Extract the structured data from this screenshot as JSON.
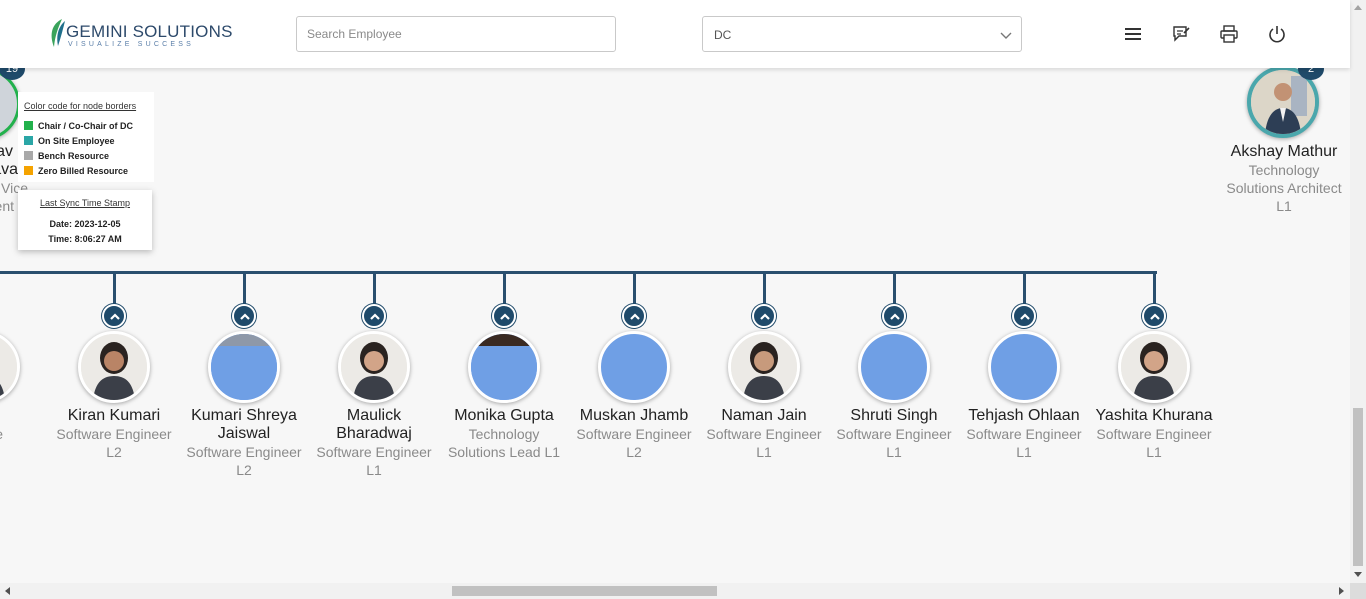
{
  "header": {
    "logo_title": "GEMINI SOLUTIONS",
    "logo_tagline": "VISUALIZE SUCCESS",
    "search_placeholder": "Search Employee",
    "dc_select_value": "DC",
    "icons": [
      "menu-icon",
      "feedback-icon",
      "print-icon",
      "power-icon"
    ]
  },
  "legend": {
    "title": "Color code for node borders",
    "items": [
      {
        "label": "Chair / Co-Chair of DC",
        "color": "#22b14c"
      },
      {
        "label": "On Site Employee",
        "color": "#2aa6a6"
      },
      {
        "label": "Bench Resource",
        "color": "#a9a9a9"
      },
      {
        "label": "Zero Billed Resource",
        "color": "#f5a300"
      }
    ]
  },
  "sync": {
    "title": "Last Sync Time Stamp",
    "date": "Date: 2023-12-05",
    "time": "Time: 8:06:27 AM"
  },
  "partial_left_node": {
    "count": "19",
    "name_line1": "av",
    "name_line2": "ava",
    "role_line1": "Vice",
    "role_line2": "ent"
  },
  "right_node": {
    "count": "2",
    "name": "Akshay Mathur",
    "role_line1": "Technology",
    "role_line2": "Solutions Architect",
    "role_line3": "L1"
  },
  "children": [
    {
      "name_line1": "huja",
      "name_line2": "",
      "role_line1": "ftware",
      "role_line2": "r L1",
      "role_line3": "",
      "photo": true
    },
    {
      "name_line1": "Kiran Kumari",
      "name_line2": "",
      "role_line1": "Software Engineer",
      "role_line2": "L2",
      "role_line3": "",
      "photo": true
    },
    {
      "name_line1": "Kumari Shreya",
      "name_line2": "Jaiswal",
      "role_line1": "Software Engineer",
      "role_line2": "L2",
      "role_line3": "",
      "photo": false
    },
    {
      "name_line1": "Maulick",
      "name_line2": "Bharadwaj",
      "role_line1": "Software Engineer",
      "role_line2": "L1",
      "role_line3": "",
      "photo": true
    },
    {
      "name_line1": "Monika Gupta",
      "name_line2": "",
      "role_line1": "Technology",
      "role_line2": "Solutions Lead L1",
      "role_line3": "",
      "photo": false
    },
    {
      "name_line1": "Muskan Jhamb",
      "name_line2": "",
      "role_line1": "Software Engineer",
      "role_line2": "L2",
      "role_line3": "",
      "photo": false
    },
    {
      "name_line1": "Naman Jain",
      "name_line2": "",
      "role_line1": "Software Engineer",
      "role_line2": "L1",
      "role_line3": "",
      "photo": true
    },
    {
      "name_line1": "Shruti Singh",
      "name_line2": "",
      "role_line1": "Software Engineer",
      "role_line2": "L1",
      "role_line3": "",
      "photo": false
    },
    {
      "name_line1": "Tehjash Ohlaan",
      "name_line2": "",
      "role_line1": "Software Engineer",
      "role_line2": "L1",
      "role_line3": "",
      "photo": false
    },
    {
      "name_line1": "Yashita Khurana",
      "name_line2": "",
      "role_line1": "Software Engineer",
      "role_line2": "L1",
      "role_line3": "",
      "photo": true
    }
  ],
  "colors": {
    "connector": "#2a4f6e",
    "placeholder_avatar": "#6f9fe5",
    "onsite_border": "#2aa6a6"
  }
}
